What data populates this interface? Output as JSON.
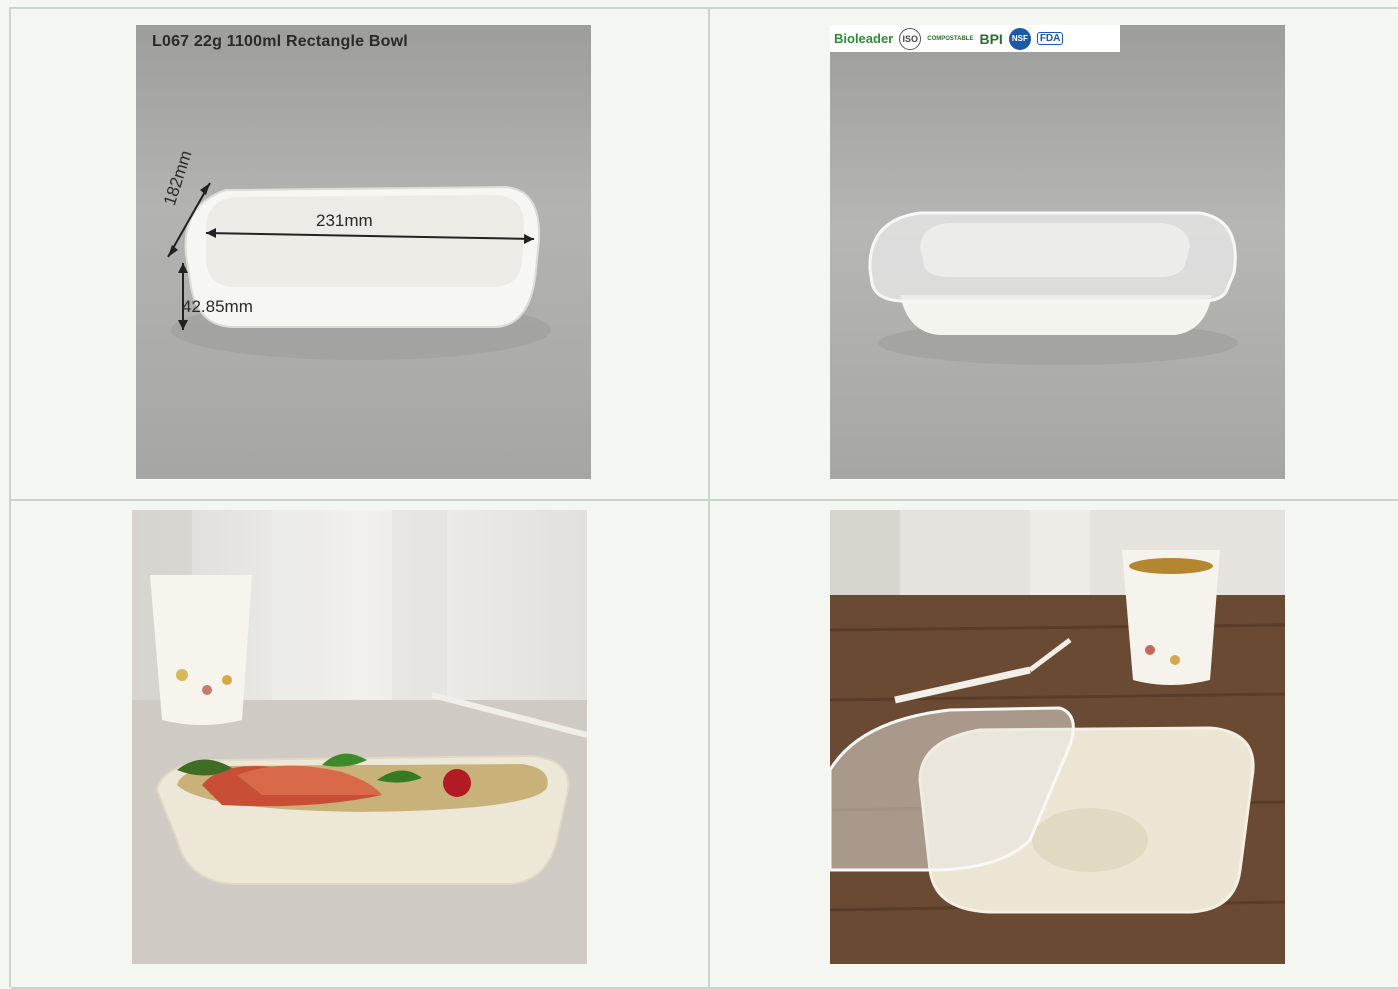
{
  "product": {
    "caption": "L067  22g  1100ml Rectangle Bowl",
    "dimensions": {
      "width": "231mm",
      "depth": "182mm",
      "height": "42.85mm"
    }
  },
  "certifications": {
    "brand": "Bioleader",
    "badges": [
      "ISO",
      "COMPOSTABLE",
      "BPI",
      "NSF",
      "FDA"
    ]
  },
  "photos": [
    {
      "name": "bowl-with-dimensions"
    },
    {
      "name": "bowl-with-lid"
    },
    {
      "name": "bowl-with-seafood-pasta"
    },
    {
      "name": "bowl-lid-on-wood-table"
    }
  ],
  "colors": {
    "background": "#f4f6f2",
    "grid_border": "#c8d6c8",
    "backdrop_grey": "#a9a9a7",
    "bowl_white": "#f5f4ef",
    "bagasse_cream": "#ece6d6",
    "wood_brown": "#6b4a33"
  }
}
